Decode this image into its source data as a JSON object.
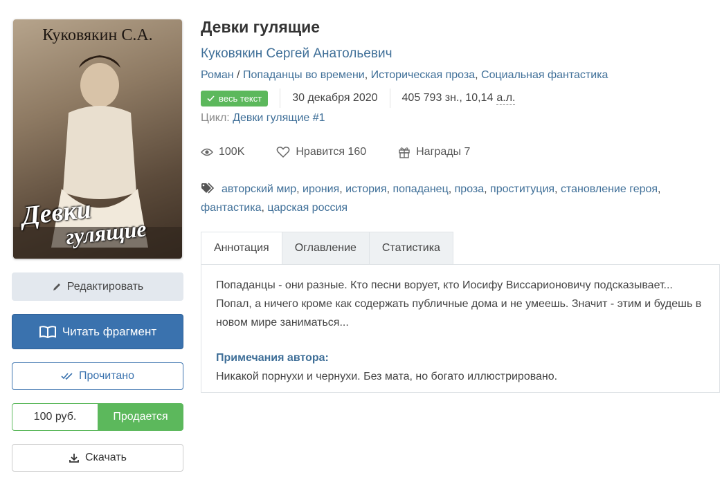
{
  "cover": {
    "author_text": "Куковякин С.А.",
    "title_line1": "Девки",
    "title_line2": "гулящие"
  },
  "left_buttons": {
    "edit": "Редактировать",
    "read_fragment": "Читать фрагмент",
    "read_done": "Прочитано",
    "price": "100 руб.",
    "for_sale": "Продается",
    "download": "Скачать"
  },
  "book": {
    "title": "Девки гулящие",
    "author": "Куковякин Сергей Анатольевич",
    "genres": [
      "Роман",
      "Попаданцы во времени",
      "Историческая проза",
      "Социальная фантастика"
    ],
    "genre_separator_1": " / ",
    "genre_separator_2": ", ",
    "genre_separator_3": ", ",
    "badge": "весь текст",
    "date": "30 декабря 2020",
    "size_text": "405 793 зн., 10,14",
    "size_unit": "а.л.",
    "cycle_label": "Цикл:",
    "cycle_value": "Девки гулящие #1"
  },
  "stats": {
    "views": "100K",
    "likes_label": "Нравится 160",
    "awards_label": "Награды 7"
  },
  "tags": [
    "авторский мир",
    "ирония",
    "история",
    "попаданец",
    "проза",
    "проституция",
    "становление героя",
    "фантастика",
    "царская россия"
  ],
  "tabs": [
    "Аннотация",
    "Оглавление",
    "Статистика"
  ],
  "annotation": {
    "text": "Попаданцы - они разные. Кто песни ворует, кто Иосифу Виссарионовичу подсказывает... Попал, а ничего кроме как содержать публичные дома и не умеешь. Значит - этим и будешь в новом мире заниматься...",
    "notes_title": "Примечания автора:",
    "notes_text": "Никакой порнухи и чернухи. Без мата, но богато иллюстрировано."
  },
  "colors": {
    "link": "#3f6f98",
    "primary": "#3a72ae",
    "success": "#5cb85c"
  },
  "icons": {
    "edit": "pencil-icon",
    "read": "open-book-icon",
    "done": "double-check-icon",
    "download": "download-icon",
    "badge": "check-icon",
    "views": "eye-icon",
    "likes": "heart-icon",
    "awards": "gift-icon",
    "tags": "tags-icon"
  }
}
